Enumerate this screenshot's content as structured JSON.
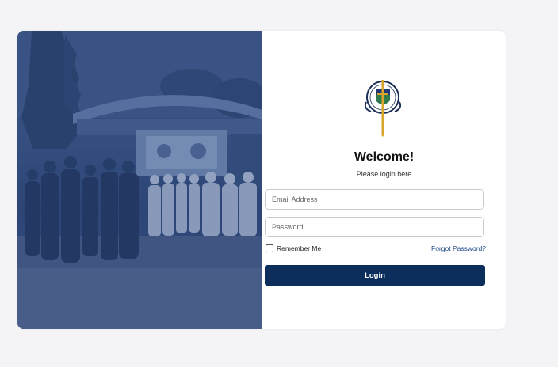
{
  "login": {
    "heading": "Welcome!",
    "subtitle": "Please login here",
    "email_placeholder": "Email Address",
    "password_placeholder": "Password",
    "remember_label": "Remember Me",
    "forgot_label": "Forgot Password?",
    "login_label": "Login"
  },
  "colors": {
    "page_bg": "#f4f4f6",
    "overlay": "#2d4677",
    "primary_button": "#0b2e5c",
    "link": "#1e4b8a"
  },
  "icons": [
    "school-crest-logo",
    "checkbox"
  ]
}
